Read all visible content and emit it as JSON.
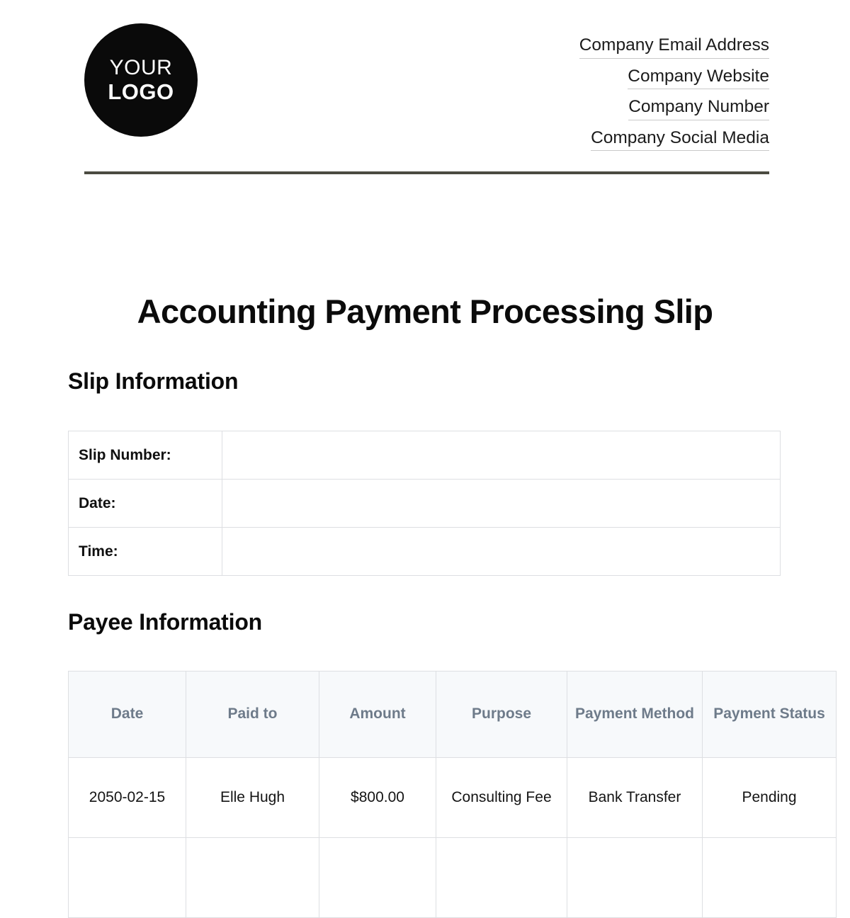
{
  "header": {
    "logo": {
      "line1": "YOUR",
      "line2": "LOGO"
    },
    "contact": [
      "Company Email Address",
      "Company Website",
      "Company Number",
      "Company Social Media"
    ]
  },
  "title": "Accounting Payment Processing Slip",
  "sections": {
    "slip": {
      "heading": "Slip Information",
      "rows": [
        {
          "label": "Slip Number:",
          "value": ""
        },
        {
          "label": "Date:",
          "value": ""
        },
        {
          "label": "Time:",
          "value": ""
        }
      ]
    },
    "payee": {
      "heading": "Payee Information",
      "columns": [
        "Date",
        "Paid to",
        "Amount",
        "Purpose",
        "Payment Method",
        "Payment Status"
      ],
      "rows": [
        {
          "date": "2050-02-15",
          "paid_to": "Elle Hugh",
          "amount": "$800.00",
          "purpose": "Consulting Fee",
          "payment_method": "Bank Transfer",
          "payment_status": "Pending"
        },
        {
          "date": "",
          "paid_to": "",
          "amount": "",
          "purpose": "",
          "payment_method": "",
          "payment_status": ""
        }
      ]
    }
  },
  "colors": {
    "rule": "#4b4b41",
    "logo_bg": "#0a0a0a",
    "table_border": "#dddfe2",
    "table_header_bg": "#f7f9fb",
    "table_header_text": "#6e7b8a"
  }
}
